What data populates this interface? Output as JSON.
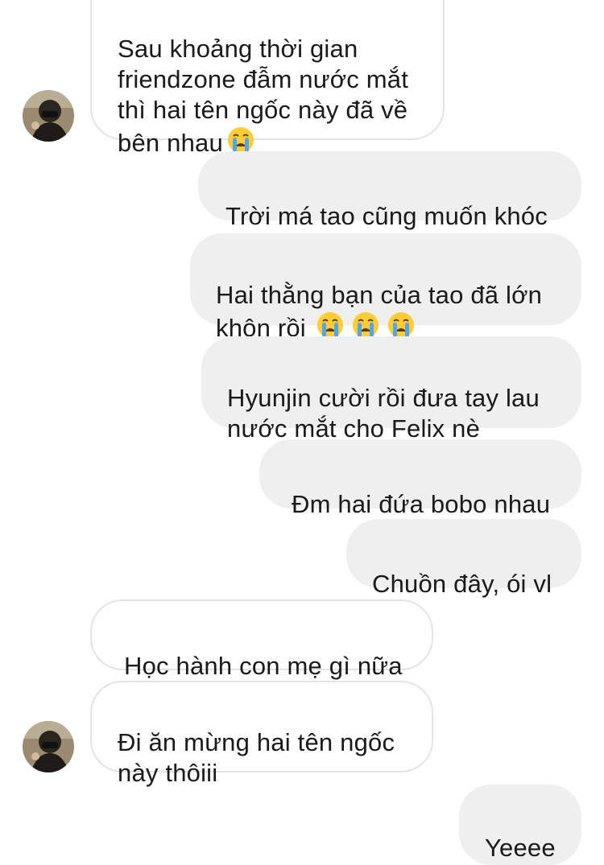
{
  "messages": [
    {
      "id": "m1",
      "side": "in",
      "text": "Sau khoảng thời gian\nfriendzone đẫm nước mắt\nthì hai tên ngốc này đã về\nbên nhau",
      "emoji_count": 1
    },
    {
      "id": "m2",
      "side": "out",
      "text": "Trời má tao cũng muốn khóc",
      "emoji_count": 0
    },
    {
      "id": "m3",
      "side": "out",
      "text": "Hai thằng bạn của tao đã lớn\nkhôn rồi",
      "emoji_count": 3
    },
    {
      "id": "m4",
      "side": "out",
      "text": " Hyunjin cười rồi đưa tay lau\nnước mắt cho Felix nè",
      "emoji_count": 0
    },
    {
      "id": "m5",
      "side": "out",
      "text": "Đm hai đứa bobo nhau",
      "emoji_count": 0
    },
    {
      "id": "m6",
      "side": "out",
      "text": "Chuồn đây, ói vl",
      "emoji_count": 0
    },
    {
      "id": "m7",
      "side": "in",
      "text": "Học hành con mẹ gì nữa",
      "emoji_count": 0
    },
    {
      "id": "m8",
      "side": "in",
      "text": "Đi ăn mừng hai tên ngốc\nnày thôiii",
      "emoji_count": 0
    },
    {
      "id": "m9",
      "side": "out",
      "text": "Yeeee",
      "emoji_count": 0
    }
  ],
  "emoji": "loudly-crying-face-icon",
  "colors": {
    "incoming_bg": "#ffffff",
    "incoming_border": "#e3e3e3",
    "outgoing_bg": "#efefef",
    "text": "#1a1a1a"
  }
}
